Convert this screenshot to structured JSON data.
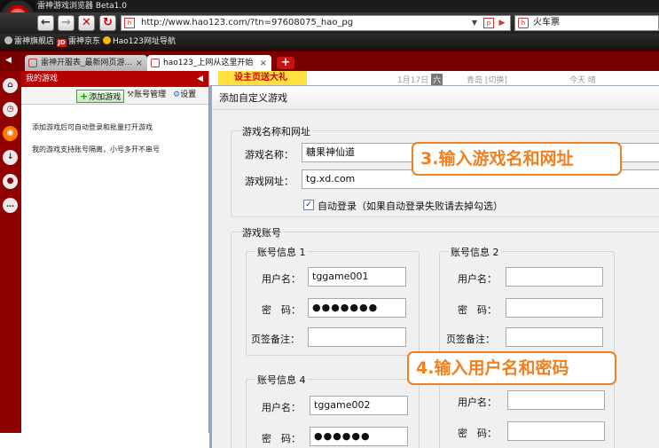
{
  "window": {
    "title": "雷神游戏浏览器 Beta1.0"
  },
  "nav": {
    "address": "http://www.hao123.com/?tn=97608075_hao_pg",
    "search_value": "火车票"
  },
  "bookmarks": [
    {
      "label": "雷神旗舰店",
      "icon": "gear-icon"
    },
    {
      "label": "雷神京东",
      "icon": "jd-icon"
    },
    {
      "label": "Hao123网址导航",
      "icon": "hao123-icon"
    }
  ],
  "tabs": [
    {
      "label": "雷神开服表_最新网页游...",
      "active": false
    },
    {
      "label": "hao123_上网从这里开始",
      "active": true
    }
  ],
  "panel": {
    "title": "我的游戏",
    "add_game": "添加游戏",
    "account_mgmt": "账号管理",
    "settings": "设置",
    "info1": "添加游戏后可自动登录和批量打开游戏",
    "info2": "我的游戏支持账号隔离，小号多开不串号"
  },
  "website": {
    "banner": "设主页送大礼",
    "date": "1月17日",
    "weekday": "六",
    "city": "青岛 [切换]",
    "weather": "今天 晴"
  },
  "dialog": {
    "title": "添加自定义游戏",
    "section1": "游戏名称和网址",
    "name_label": "游戏名称：",
    "name_value": "糖果神仙道",
    "url_label": "游戏网址：",
    "url_value": "tg.xd.com",
    "autologin_label": "自动登录（如果自动登录失败请去掉勾选）",
    "autologin_checked": true,
    "section2": "游戏账号",
    "accounts": [
      {
        "title": "账号信息 1",
        "user_label": "用户名：",
        "user": "tggame001",
        "pw_label": "密　码：",
        "pw": "●●●●●●●",
        "note_label": "页签备注：",
        "note": ""
      },
      {
        "title": "账号信息 2",
        "user_label": "用户名：",
        "user": "",
        "pw_label": "密　码：",
        "pw": "",
        "note_label": "页签备注：",
        "note": ""
      },
      {
        "title": "账号信息 4",
        "user_label": "用户名：",
        "user": "tggame002",
        "pw_label": "密　码：",
        "pw": "●●●●●●"
      },
      {
        "user_label": "用户名：",
        "user": "",
        "pw_label": "密　码：",
        "pw": ""
      }
    ]
  },
  "callouts": {
    "step3": "3.输入游戏名和网址",
    "step4": "4.输入用户名和密码"
  },
  "colors": {
    "brand_red": "#b70000",
    "callout_orange": "#f07f20"
  }
}
